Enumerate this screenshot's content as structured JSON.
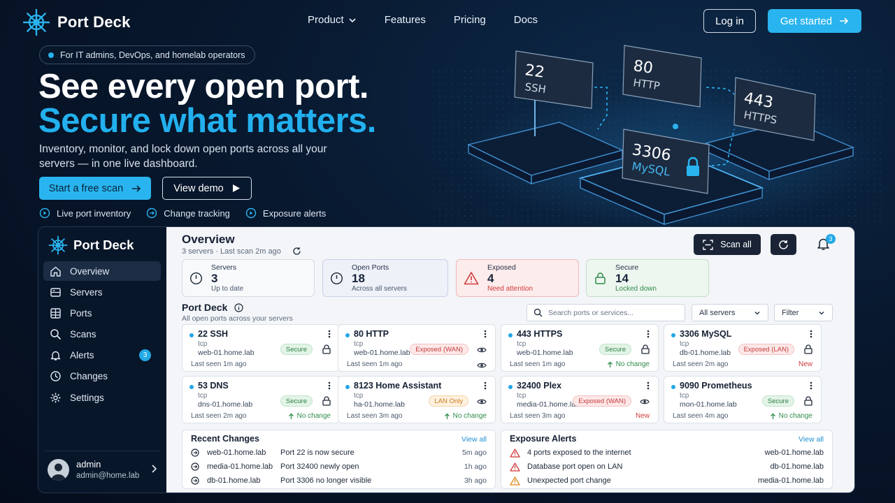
{
  "brand": {
    "name": "Port Deck"
  },
  "nav": {
    "links": [
      "Product",
      "Features",
      "Pricing",
      "Docs"
    ],
    "login": "Log in",
    "get_started": "Get started"
  },
  "hero": {
    "audience": "For IT admins, DevOps, and homelab operators",
    "headline_1": "See every open port.",
    "headline_2": "Secure what matters.",
    "subtitle": "Inventory, monitor, and lock down open ports across all your servers — in one live dashboard.",
    "cta_primary": "Start a free scan",
    "cta_secondary": "View demo",
    "features": [
      "Live port inventory",
      "Change tracking",
      "Exposure alerts"
    ]
  },
  "illustration": {
    "tiles": [
      {
        "port": "22",
        "service": "SSH"
      },
      {
        "port": "80",
        "service": "HTTP"
      },
      {
        "port": "443",
        "service": "HTTPS"
      },
      {
        "port": "3306",
        "service": "MySQL"
      }
    ]
  },
  "sidebar": {
    "brand": "Port Deck",
    "items": [
      {
        "label": "Overview",
        "icon": "home-icon",
        "active": true
      },
      {
        "label": "Servers",
        "icon": "server-icon"
      },
      {
        "label": "Ports",
        "icon": "ports-icon"
      },
      {
        "label": "Scans",
        "icon": "search-icon"
      },
      {
        "label": "Alerts",
        "icon": "bell-icon",
        "badge": "3"
      },
      {
        "label": "Changes",
        "icon": "clock-icon"
      },
      {
        "label": "Settings",
        "icon": "gear-icon"
      }
    ],
    "user": {
      "name": "admin",
      "email": "admin@home.lab"
    }
  },
  "overview": {
    "title": "Overview",
    "servers_count": "3 servers",
    "last_scan": "Last scan 2m ago",
    "scan_all": "Scan all",
    "notif_count": "3"
  },
  "stats": [
    {
      "label": "Servers",
      "value": "3",
      "hint": "Up to date"
    },
    {
      "label": "Open Ports",
      "value": "18",
      "hint": "Across all servers"
    },
    {
      "label": "Exposed",
      "value": "4",
      "hint": "Need attention"
    },
    {
      "label": "Secure",
      "value": "14",
      "hint": "Locked down"
    }
  ],
  "port_deck": {
    "title": "Port Deck",
    "subtitle": "All open ports across your servers",
    "search_placeholder": "Search ports or services...",
    "server_filter": "All servers",
    "filter": "Filter",
    "cards": [
      {
        "name": "22 SSH",
        "proto": "tcp",
        "host": "web-01.home.lab",
        "seen": "Last seen 1m ago",
        "tag": "Secure",
        "tag_type": "secure",
        "change": ""
      },
      {
        "name": "80 HTTP",
        "proto": "tcp",
        "host": "web-01.home.lab",
        "seen": "Last seen 1m ago",
        "tag": "Exposed (WAN)",
        "tag_type": "exposed",
        "change": ""
      },
      {
        "name": "443 HTTPS",
        "proto": "tcp",
        "host": "web-01.home.lab",
        "seen": "Last seen 1m ago",
        "tag": "Secure",
        "tag_type": "secure",
        "change": "No change"
      },
      {
        "name": "3306 MySQL",
        "proto": "tcp",
        "host": "db-01.home.lab",
        "seen": "Last seen 2m ago",
        "tag": "Exposed (LAN)",
        "tag_type": "exposed",
        "change": "New"
      },
      {
        "name": "53 DNS",
        "proto": "tcp",
        "host": "dns-01.home.lab",
        "seen": "Last seen 2m ago",
        "tag": "Secure",
        "tag_type": "secure",
        "change": "No change"
      },
      {
        "name": "8123 Home Assistant",
        "proto": "tcp",
        "host": "ha-01.home.lab",
        "seen": "Last seen 3m ago",
        "tag": "LAN Only",
        "tag_type": "lan",
        "change": "No change"
      },
      {
        "name": "32400 Plex",
        "proto": "tcp",
        "host": "media-01.home.lab",
        "seen": "Last seen 3m ago",
        "tag": "Exposed (WAN)",
        "tag_type": "exposed",
        "change": "New"
      },
      {
        "name": "9090 Prometheus",
        "proto": "tcp",
        "host": "mon-01.home.lab",
        "seen": "Last seen 4m ago",
        "tag": "Secure",
        "tag_type": "secure",
        "change": "No change"
      }
    ]
  },
  "recent_changes": {
    "title": "Recent Changes",
    "view_all": "View all",
    "rows": [
      {
        "host": "web-01.home.lab",
        "desc": "Port 22 is now secure",
        "time": "5m ago"
      },
      {
        "host": "media-01.home.lab",
        "desc": "Port 32400 newly open",
        "time": "1h ago"
      },
      {
        "host": "db-01.home.lab",
        "desc": "Port 3306 no longer visible",
        "time": "3h ago"
      }
    ]
  },
  "exposure_alerts": {
    "title": "Exposure Alerts",
    "view_all": "View all",
    "rows": [
      {
        "msg": "4 ports exposed to the internet",
        "host": "web-01.home.lab",
        "level": "critical"
      },
      {
        "msg": "Database port open on LAN",
        "host": "db-01.home.lab",
        "level": "critical"
      },
      {
        "msg": "Unexpected port change",
        "host": "media-01.home.lab",
        "level": "warning"
      }
    ]
  },
  "colors": {
    "accent": "#2ab4ef",
    "danger": "#d13b3b",
    "success": "#2f8c4a",
    "warning": "#e08a1e"
  }
}
